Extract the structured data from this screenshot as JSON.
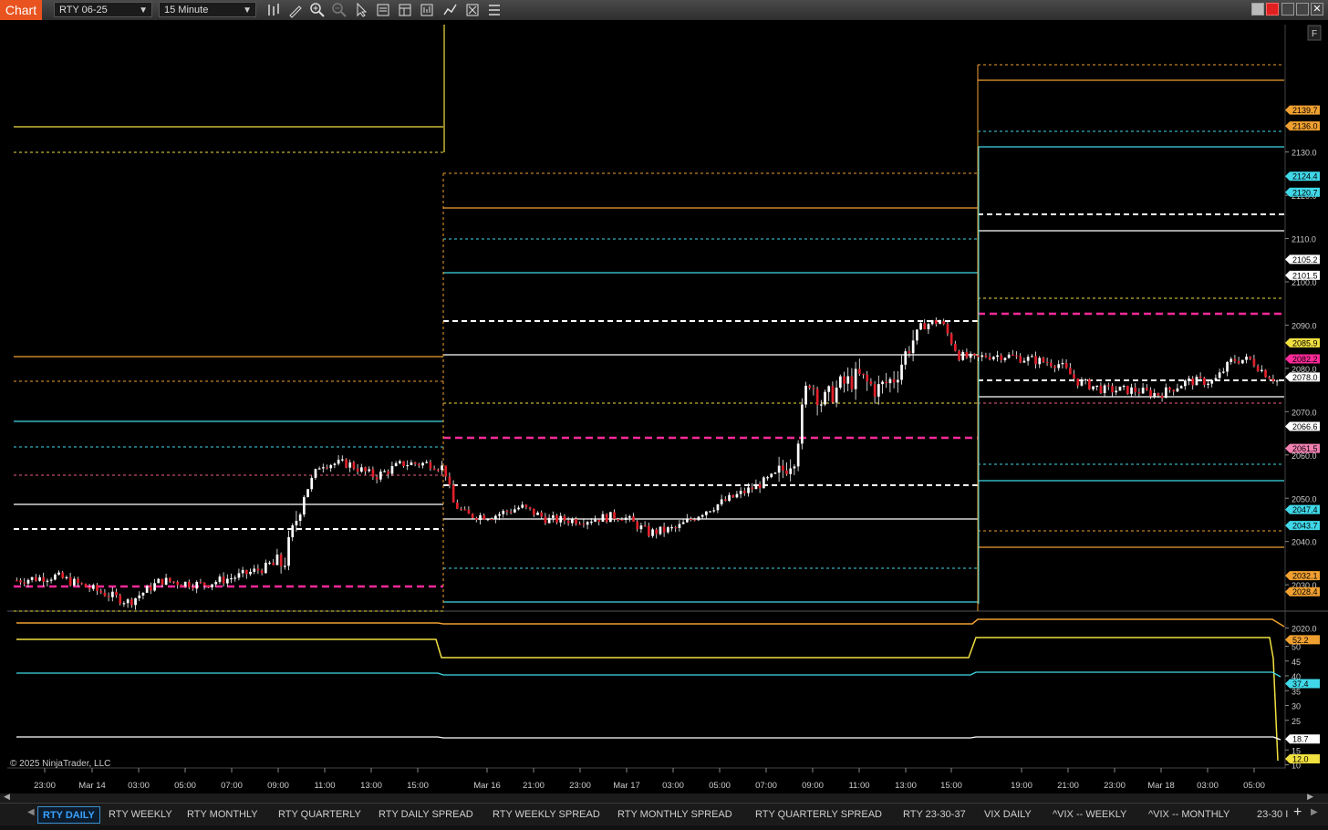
{
  "toolbar": {
    "chart_tab_label": "Chart",
    "instrument": "RTY 06-25",
    "interval": "15 Minute",
    "icons": [
      "bar-type-icon",
      "draw-pencil-icon",
      "zoom-in-icon",
      "zoom-out-icon",
      "pointer-icon",
      "properties-icon",
      "template-icon",
      "data-box-icon",
      "indicators-icon",
      "strategies-icon",
      "menu-list-icon"
    ]
  },
  "window_controls": [
    "restore-icon",
    "close-red-icon",
    "minimize-icon",
    "maximize-icon",
    "close-icon"
  ],
  "colors": {
    "orange": "#f0a030",
    "yellow": "#f0e040",
    "cyan": "#40d8e8",
    "white": "#ffffff",
    "magenta": "#ff2a9a",
    "pink": "#f06080",
    "up_candle": "#ffffff",
    "down_candle": "#e0202a"
  },
  "price_axis": {
    "ticks": [
      "2130.0",
      "2120.0",
      "2110.0",
      "2100.0",
      "2090.0",
      "2080.0",
      "2070.0",
      "2060.0",
      "2050.0",
      "2040.0",
      "2030.0",
      "2020.0"
    ],
    "labels": [
      {
        "text": "2139.7",
        "color": "#f0a030"
      },
      {
        "text": "2136.0",
        "color": "#f0a030"
      },
      {
        "text": "2124.4",
        "color": "#40d8e8"
      },
      {
        "text": "2120.7",
        "color": "#40d8e8"
      },
      {
        "text": "2105.2",
        "color": "#ffffff"
      },
      {
        "text": "2101.5",
        "color": "#ffffff"
      },
      {
        "text": "2085.9",
        "color": "#f0e040"
      },
      {
        "text": "2082.2",
        "color": "#ff2a9a"
      },
      {
        "text": "2078.0",
        "color": "#ffffff"
      },
      {
        "text": "2066.6",
        "color": "#ffffff"
      },
      {
        "text": "2061.5",
        "color": "#f080b0"
      },
      {
        "text": "2047.4",
        "color": "#40d8e8"
      },
      {
        "text": "2043.7",
        "color": "#40d8e8"
      },
      {
        "text": "2032.1",
        "color": "#f0a030"
      },
      {
        "text": "2028.4",
        "color": "#f0a030"
      }
    ],
    "corner_label": "F"
  },
  "lower_axis": {
    "ticks": [
      "50",
      "45",
      "40",
      "35",
      "30",
      "25",
      "15",
      "10"
    ],
    "labels": [
      {
        "text": "52.2",
        "color": "#f0a030"
      },
      {
        "text": "37.4",
        "color": "#40d8e8"
      },
      {
        "text": "18.7",
        "color": "#ffffff"
      },
      {
        "text": "12.0",
        "color": "#f0e040"
      }
    ]
  },
  "time_axis": [
    "23:00",
    "Mar 14",
    "03:00",
    "05:00",
    "07:00",
    "09:00",
    "11:00",
    "13:00",
    "15:00",
    "Mar 16",
    "21:00",
    "23:00",
    "Mar 17",
    "03:00",
    "05:00",
    "07:00",
    "09:00",
    "11:00",
    "13:00",
    "15:00",
    "19:00",
    "21:00",
    "23:00",
    "Mar 18",
    "03:00",
    "05:00"
  ],
  "copyright": "© 2025 NinjaTrader, LLC",
  "tabs": [
    "RTY DAILY",
    "RTY WEEKLY",
    "RTY MONTHLY",
    "RTY QUARTERLY",
    "RTY DAILY SPREAD",
    "RTY WEEKLY SPREAD",
    "RTY MONTHLY SPREAD",
    "RTY QUARTERLY SPREAD",
    "RTY 23-30-37",
    "VIX DAILY",
    "^VIX -- WEEKLY",
    "^VIX -- MONTHLY",
    "23-30 I"
  ],
  "active_tab": "RTY DAILY"
}
